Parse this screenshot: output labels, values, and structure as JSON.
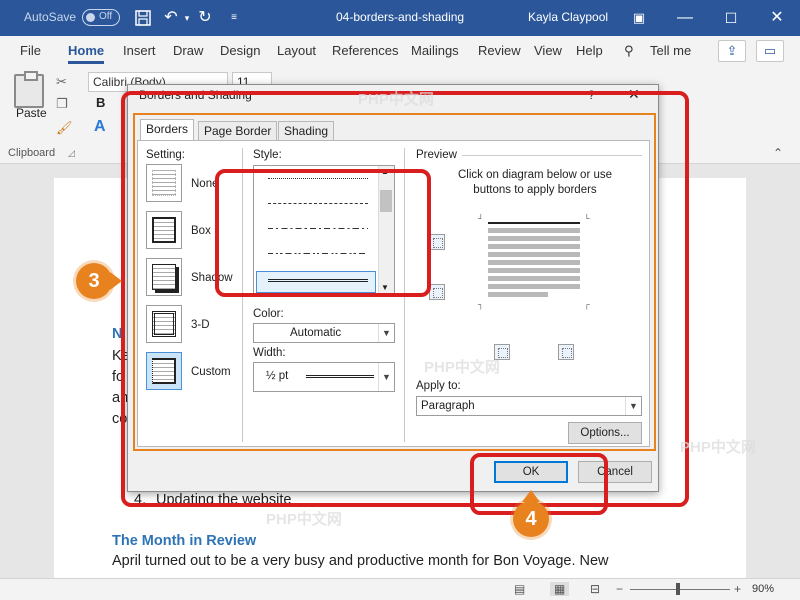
{
  "titlebar": {
    "autosave_label": "AutoSave",
    "autosave_state": "Off",
    "doc_title": "04-borders-and-shading",
    "user": "Kayla Claypool"
  },
  "tabs": [
    "File",
    "Home",
    "Insert",
    "Draw",
    "Design",
    "Layout",
    "References",
    "Mailings",
    "Review",
    "View",
    "Help"
  ],
  "active_tab": "Home",
  "tell_me": "Tell me",
  "ribbon": {
    "paste_label": "Paste",
    "font_name": "Calibri (Body)",
    "font_size": "11",
    "bold_label": "B",
    "font_color_label": "A",
    "group_clipboard": "Clipboard"
  },
  "document": {
    "behind_heading_char": "N",
    "behind_lines": [
      "Ke",
      "fo",
      "an",
      "co"
    ],
    "list_item_number": "4.",
    "list_item_text": "Updating the website",
    "heading": "The Month in Review",
    "para1": "April turned out to be a very busy and productive month for Bon Voyage. New"
  },
  "dialog": {
    "title": "Borders and Shading",
    "help": "?",
    "close": "✕",
    "tabs": [
      "Borders",
      "Page Border",
      "Shading"
    ],
    "active_tab": "Borders",
    "setting_label": "Setting:",
    "settings": [
      "None",
      "Box",
      "Shadow",
      "3-D",
      "Custom"
    ],
    "selected_setting": "Custom",
    "style_label": "Style:",
    "color_label": "Color:",
    "color_value": "Automatic",
    "width_label": "Width:",
    "width_value": "½ pt",
    "preview_label": "Preview",
    "preview_hint": "Click on diagram below or use buttons to apply borders",
    "apply_to_label": "Apply to:",
    "apply_to_value": "Paragraph",
    "options_button": "Options...",
    "ok_button": "OK",
    "cancel_button": "Cancel"
  },
  "annotations": {
    "step3": "3",
    "step4": "4",
    "color": "#d81e1e",
    "badge_color": "#e8821e"
  },
  "status": {
    "zoom": "90%"
  },
  "watermark": "PHP中文网",
  "colors": {
    "titlebar": "#2b579a",
    "heading": "#2e74b5"
  }
}
